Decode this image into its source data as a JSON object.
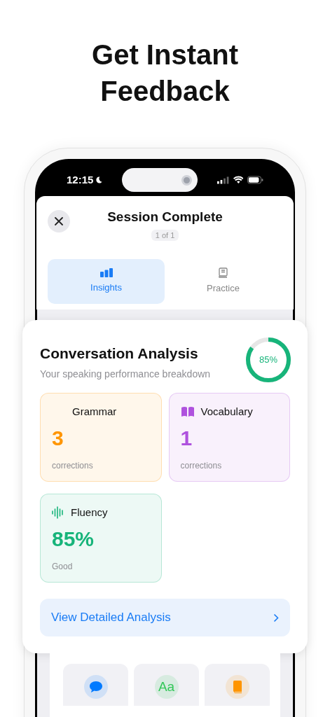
{
  "headline": "Get Instant Feedback",
  "status_bar": {
    "time": "12:15"
  },
  "sheet": {
    "title": "Session Complete",
    "page_indicator": "1 of 1"
  },
  "tabs": [
    {
      "label": "Insights",
      "kind": "chart",
      "selected": true
    },
    {
      "label": "Practice",
      "kind": "book",
      "selected": false
    }
  ],
  "analysis": {
    "title": "Conversation Analysis",
    "subtitle": "Your speaking performance breakdown",
    "score": {
      "reading": "85%",
      "level": 0.85
    },
    "metrics": [
      {
        "label": "Grammar",
        "kind": "plain",
        "value": "3",
        "caption": "corrections",
        "color": "#ff9500"
      },
      {
        "label": "Vocabulary",
        "kind": "book",
        "value": "1",
        "caption": "corrections",
        "color": "#af52de"
      },
      {
        "label": "Fluency",
        "kind": "wave",
        "value": "85%",
        "caption": "Good",
        "color": "#17b47a"
      }
    ],
    "button": "View Detailed Analysis"
  },
  "shortcuts": [
    {
      "kind": "chat",
      "color": "#007aff"
    },
    {
      "kind": "text",
      "label": "Aa",
      "color": "#34c759"
    },
    {
      "kind": "book",
      "color": "#ff9500"
    }
  ]
}
